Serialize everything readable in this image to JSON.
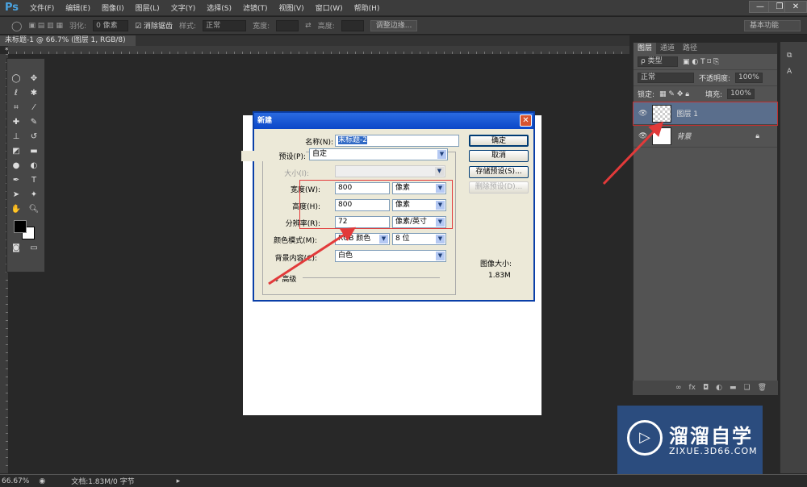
{
  "app": {
    "logo": "Ps",
    "menu": [
      "文件(F)",
      "编辑(E)",
      "图像(I)",
      "图层(L)",
      "文字(Y)",
      "选择(S)",
      "滤镜(T)",
      "视图(V)",
      "窗口(W)",
      "帮助(H)"
    ],
    "window_controls": [
      "—",
      "❐",
      "✕"
    ]
  },
  "options": {
    "feather_label": "羽化:",
    "feather_value": "0 像素",
    "antialias_label": "消除锯齿",
    "antialias_checked": true,
    "style_label": "样式:",
    "style_value": "正常",
    "width_label": "宽度:",
    "height_label": "高度:",
    "refine_edge": "调整边缘...",
    "workspace": "基本功能"
  },
  "document": {
    "tab": "未标题-1 @ 66.7% (图层 1, RGB/8) *",
    "close": "×"
  },
  "dialog": {
    "title": "新建",
    "close": "✕",
    "name_label": "名称(N):",
    "name_value": "未标题-2",
    "preset_label": "预设(P):",
    "preset_value": "自定",
    "size_label": "大小(I):",
    "width_label": "宽度(W):",
    "width_value": "800",
    "width_unit": "像素",
    "height_label": "高度(H):",
    "height_value": "800",
    "height_unit": "像素",
    "resolution_label": "分辨率(R):",
    "resolution_value": "72",
    "resolution_unit": "像素/英寸",
    "color_mode_label": "颜色模式(M):",
    "color_mode_value": "RGB 颜色",
    "bit_depth": "8 位",
    "bg_label": "背景内容(C):",
    "bg_value": "白色",
    "advanced": "高级",
    "ok": "确定",
    "cancel": "取消",
    "save_preset": "存储预设(S)...",
    "delete_preset": "删除预设(D)...",
    "image_size_label": "图像大小:",
    "image_size_value": "1.83M"
  },
  "layers_panel": {
    "tabs": [
      "图层",
      "通道",
      "路径"
    ],
    "filter": "ρ 类型",
    "blend": "正常",
    "opacity_label": "不透明度:",
    "opacity": "100%",
    "lock_label": "锁定:",
    "fill_label": "填充:",
    "fill": "100%",
    "layers": [
      {
        "name": "图层 1",
        "selected": true
      },
      {
        "name": "背景",
        "locked": true
      }
    ],
    "bottom_icons": [
      "link-icon",
      "fx-icon",
      "mask-icon",
      "adjustment-icon",
      "folder-icon",
      "new-layer-icon",
      "trash-icon"
    ]
  },
  "status": {
    "zoom": "66.67%",
    "doc": "文档:1.83M/0 字节"
  },
  "watermark": {
    "brand": "溜溜自学",
    "url": "ZIXUE.3D66.COM"
  },
  "colors": {
    "annotation_red": "#e23a3a",
    "dialog_blue": "#0b47c8",
    "selected_layer": "#5a6e8c"
  }
}
